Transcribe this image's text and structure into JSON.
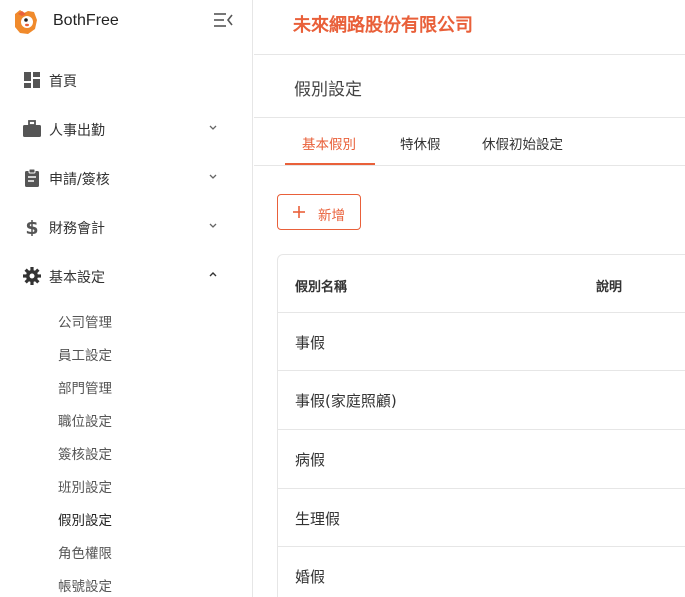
{
  "app": {
    "brand": "BothFree"
  },
  "colors": {
    "accent": "#e9603a",
    "icon": "#555555",
    "border": "#e6e6e6"
  },
  "sidebar": {
    "items": [
      {
        "label": "首頁",
        "icon": "dashboard-icon",
        "expandable": false
      },
      {
        "label": "人事出勤",
        "icon": "briefcase-icon",
        "expandable": true,
        "expanded": false
      },
      {
        "label": "申請/簽核",
        "icon": "clipboard-icon",
        "expandable": true,
        "expanded": false
      },
      {
        "label": "財務會計",
        "icon": "dollar-icon",
        "expandable": true,
        "expanded": false
      },
      {
        "label": "基本設定",
        "icon": "gear-icon",
        "expandable": true,
        "expanded": true
      }
    ],
    "submenu": [
      {
        "label": "公司管理"
      },
      {
        "label": "員工設定"
      },
      {
        "label": "部門管理"
      },
      {
        "label": "職位設定"
      },
      {
        "label": "簽核設定"
      },
      {
        "label": "班別設定"
      },
      {
        "label": "假別設定",
        "active": true
      },
      {
        "label": "角色權限"
      },
      {
        "label": "帳號設定"
      }
    ]
  },
  "header": {
    "company": "未來網路股份有限公司"
  },
  "main": {
    "title": "假別設定",
    "tabs": [
      {
        "label": "基本假別",
        "active": true
      },
      {
        "label": "特休假"
      },
      {
        "label": "休假初始設定"
      }
    ],
    "add_label": "新增",
    "table": {
      "columns": [
        "假別名稱",
        "說明"
      ],
      "rows": [
        "事假",
        "事假(家庭照顧)",
        "病假",
        "生理假",
        "婚假"
      ]
    }
  }
}
